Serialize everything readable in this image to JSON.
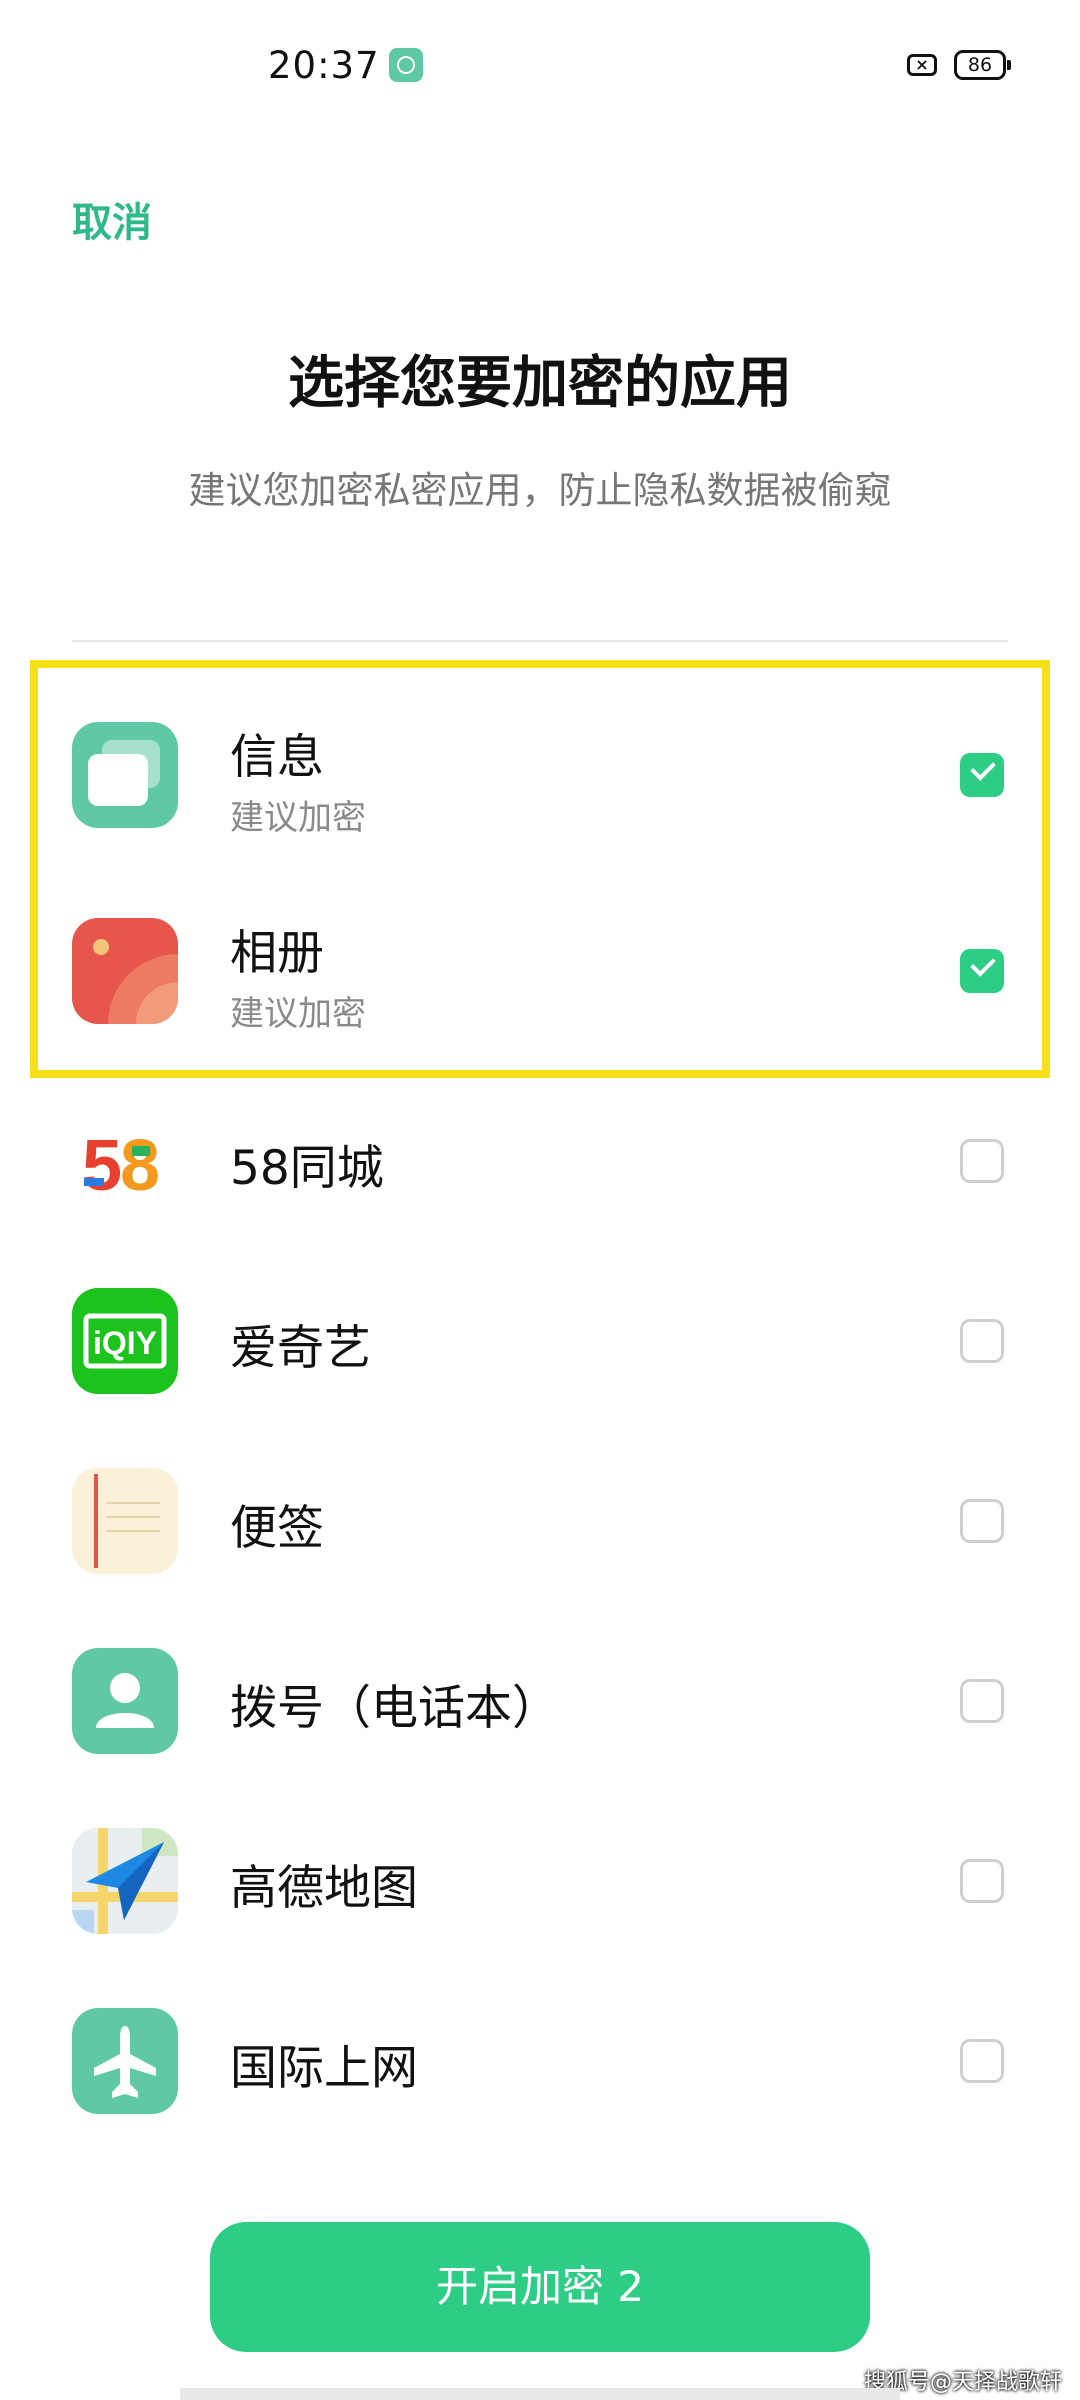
{
  "status_bar": {
    "time": "20:37",
    "battery": "86",
    "close_glyph": "×"
  },
  "header": {
    "cancel_label": "取消",
    "title": "选择您要加密的应用",
    "subtitle": "建议您加密私密应用，防止隐私数据被偷窥"
  },
  "apps": [
    {
      "name": "信息",
      "subtitle": "建议加密",
      "checked": true,
      "icon": "messages-icon"
    },
    {
      "name": "相册",
      "subtitle": "建议加密",
      "checked": true,
      "icon": "gallery-icon"
    },
    {
      "name": "58同城",
      "checked": false,
      "icon": "app-58-icon"
    },
    {
      "name": "爱奇艺",
      "checked": false,
      "icon": "iqiyi-icon"
    },
    {
      "name": "便签",
      "checked": false,
      "icon": "notes-icon"
    },
    {
      "name": "拨号（电话本）",
      "checked": false,
      "icon": "phone-contacts-icon"
    },
    {
      "name": "高德地图",
      "checked": false,
      "icon": "amap-icon"
    },
    {
      "name": "国际上网",
      "checked": false,
      "icon": "airplane-icon"
    }
  ],
  "iqiyi_logo_text": "iQIY",
  "logo_58_text": [
    "5",
    "8"
  ],
  "action": {
    "label": "开启加密 2"
  },
  "watermark": "搜狐号@天择战歌轩",
  "colors": {
    "accent": "#2ecd86",
    "highlight": "#f6e01a"
  }
}
